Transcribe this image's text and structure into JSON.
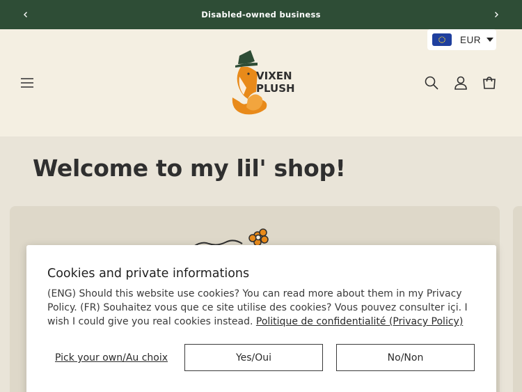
{
  "announcement": {
    "text": "Disabled-owned business"
  },
  "currency": {
    "code": "EUR"
  },
  "logo": {
    "line1": "VIXEN",
    "line2": "PLUSH"
  },
  "main": {
    "heading": "Welcome to my lil' shop!"
  },
  "cookie_banner": {
    "title": "Cookies and private informations",
    "body": "(ENG) Should this website use cookies? You can read more about them in my Privacy Policy. (FR) Souhaitez vous que ce site utilise des cookies? Vous pouvez consulter içi. I wish I could give you real cookies instead.",
    "policy_link": "Politique de confidentialité (Privacy Policy)",
    "choice_label": "Pick your own/Au choix",
    "accept_label": "Yes/Oui",
    "decline_label": "No/Non"
  },
  "colors": {
    "announcement_bg": "#2e4d36",
    "header_bg": "#f4efe2",
    "page_bg": "#e9e4d8",
    "logo_orange": "#e88a1a",
    "logo_green": "#2e4d36"
  },
  "icons": {
    "prev": "chevron-left-icon",
    "next": "chevron-right-icon",
    "menu": "hamburger-menu-icon",
    "search": "search-icon",
    "account": "user-icon",
    "cart": "cart-icon",
    "currency_flag": "eu-flag-icon",
    "currency_caret": "caret-down-icon"
  }
}
